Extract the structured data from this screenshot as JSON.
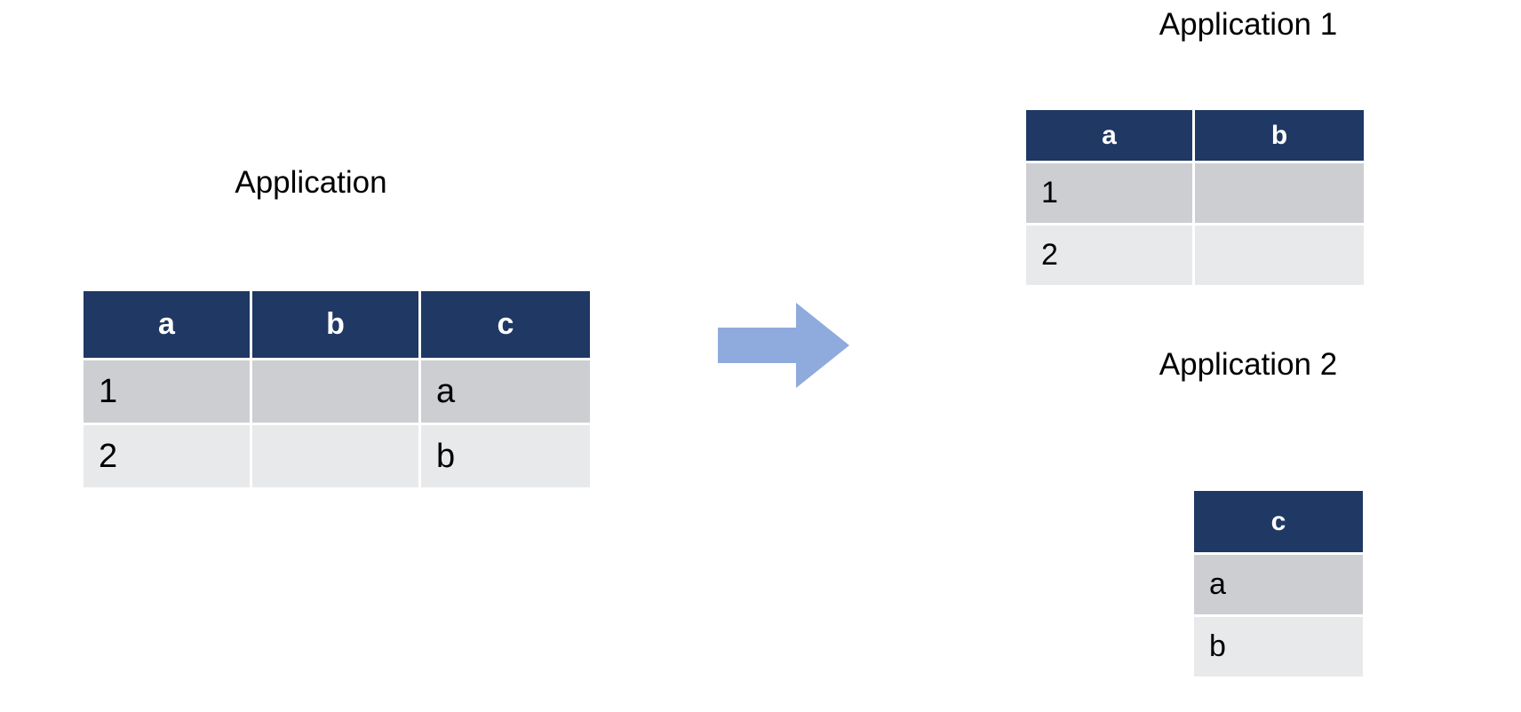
{
  "diagram": {
    "title_source": "Application",
    "title_target_1": "Application 1",
    "title_target_2": "Application 2",
    "arrow": {
      "name": "transformation-arrow",
      "direction": "right",
      "color": "#8FAADC"
    },
    "colors": {
      "header_navy": "#1F3864",
      "row_band_dark": "#CCCED2",
      "row_band_light": "#E8E9EA",
      "header_text": "#FFFFFF",
      "body_text": "#000000",
      "background": "#FFFFFF",
      "arrow_fill": "#8FAADC"
    }
  },
  "tables": {
    "source": {
      "caption": "Application",
      "headers": [
        "a",
        "b",
        "c"
      ],
      "rows": [
        [
          "1",
          "",
          "a"
        ],
        [
          "2",
          "",
          "b"
        ]
      ]
    },
    "application_1": {
      "caption": "Application 1",
      "headers": [
        "a",
        "b"
      ],
      "rows": [
        [
          "1",
          ""
        ],
        [
          "2",
          ""
        ]
      ]
    },
    "application_2": {
      "caption": "Application 2",
      "headers": [
        "c"
      ],
      "rows": [
        [
          "a"
        ],
        [
          "b"
        ]
      ]
    }
  }
}
